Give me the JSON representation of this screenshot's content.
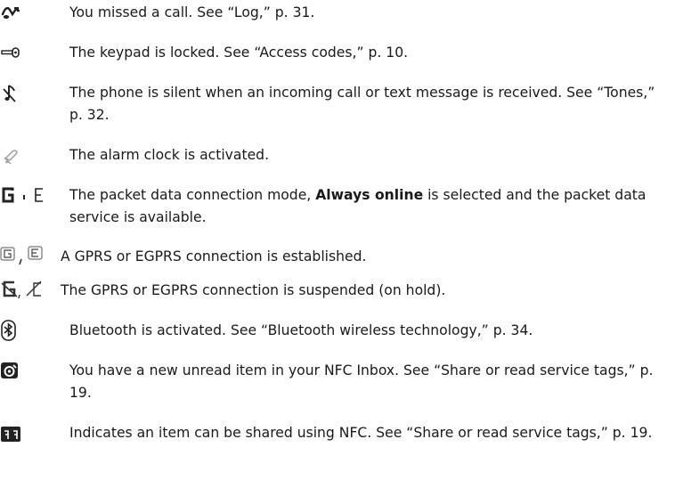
{
  "entries": [
    {
      "icon": "missed-call-icon",
      "text": "You missed a call. See “Log,” p. 31."
    },
    {
      "icon": "keyguard-icon",
      "text": "The keypad is locked. See “Access codes,” p. 10."
    },
    {
      "icon": "silent-icon",
      "text": "The phone is silent when an incoming call or text message is received. See “Tones,” p. 32."
    },
    {
      "icon": "alarm-clock-icon",
      "text": "The alarm clock is activated."
    },
    {
      "icon": "packet-data-always-online-icon",
      "text_before": "The packet data connection mode, ",
      "bold": "Always online",
      "text_after": " is selected and the packet data service is available."
    },
    {
      "icon": "gprs-egprs-connected-icon",
      "text": "A GPRS or EGPRS connection is established."
    },
    {
      "icon": "gprs-egprs-suspended-icon",
      "text": "The GPRS or EGPRS connection is suspended (on hold)."
    },
    {
      "icon": "bluetooth-icon",
      "text": "Bluetooth is activated. See “Bluetooth wireless technology,” p. 34."
    },
    {
      "icon": "nfc-inbox-icon",
      "text": "You have a new unread item in your NFC Inbox. See “Share or read service tags,” p. 19."
    },
    {
      "icon": "nfc-share-icon",
      "text": "Indicates an item can be shared using NFC. See “Share or read service tags,” p. 19."
    }
  ]
}
